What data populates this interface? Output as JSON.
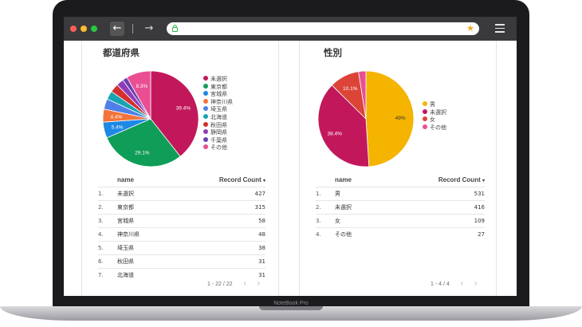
{
  "device": {
    "brand": "NoteBook Pro"
  },
  "browser": {
    "back_glyph": "←",
    "forward_glyph": "→",
    "lock_glyph": "🔒",
    "star_glyph": "★",
    "traffic_lights": [
      "#fc5f56",
      "#fdbb2e",
      "#2bc73f"
    ]
  },
  "prefecture": {
    "title": "都道府県",
    "legend": [
      "未選択",
      "東京都",
      "宮城県",
      "神奈川県",
      "埼玉県",
      "北海道",
      "秋田県",
      "静岡県",
      "千葉県",
      "その他"
    ],
    "chart_data": {
      "type": "pie",
      "title": "都道府県",
      "labels": [
        "未選択",
        "東京都",
        "宮城県",
        "神奈川県",
        "埼玉県",
        "北海道",
        "秋田県",
        "静岡県",
        "千葉県",
        "その他"
      ],
      "values": [
        39.4,
        29.1,
        5.4,
        4.4,
        3.5,
        2.9,
        2.9,
        2.5,
        1.6,
        8.3
      ],
      "colors": [
        "#c2185b",
        "#0f9d58",
        "#1e88e5",
        "#f4733a",
        "#4f7fe8",
        "#16a4b2",
        "#d32f2f",
        "#8e3db8",
        "#6a3fb3",
        "#e94f92"
      ],
      "slice_labels": [
        "39.4%",
        "29.1%",
        "5.4%",
        "4.4%",
        "",
        "",
        "",
        "",
        "",
        "8.3%"
      ]
    },
    "table": {
      "col_name": "name",
      "col_count": "Record Count",
      "sort_glyph": "▾",
      "rows": [
        {
          "idx": "1.",
          "name": "未選択",
          "count": "427"
        },
        {
          "idx": "2.",
          "name": "東京都",
          "count": "315"
        },
        {
          "idx": "3.",
          "name": "宮城県",
          "count": "58"
        },
        {
          "idx": "4.",
          "name": "神奈川県",
          "count": "48"
        },
        {
          "idx": "5.",
          "name": "埼玉県",
          "count": "38"
        },
        {
          "idx": "6.",
          "name": "秋田県",
          "count": "31"
        },
        {
          "idx": "7.",
          "name": "北海道",
          "count": "31"
        }
      ],
      "pagination": "1 - 22 / 22"
    }
  },
  "gender": {
    "title": "性別",
    "legend": [
      "男",
      "未選択",
      "女",
      "その他"
    ],
    "chart_data": {
      "type": "pie",
      "title": "性別",
      "labels": [
        "男",
        "未選択",
        "女",
        "その他"
      ],
      "values": [
        49,
        38.4,
        10.1,
        2.5
      ],
      "colors": [
        "#f4b400",
        "#c2185b",
        "#db4437",
        "#e94f92"
      ],
      "slice_labels": [
        "49%",
        "38.4%",
        "10.1%",
        ""
      ]
    },
    "table": {
      "col_name": "name",
      "col_count": "Record Count",
      "sort_glyph": "▾",
      "rows": [
        {
          "idx": "1.",
          "name": "男",
          "count": "531"
        },
        {
          "idx": "2.",
          "name": "未選択",
          "count": "416"
        },
        {
          "idx": "3.",
          "name": "女",
          "count": "109"
        },
        {
          "idx": "4.",
          "name": "その他",
          "count": "27"
        }
      ],
      "pagination": "1 - 4 / 4"
    }
  },
  "pager_glyphs": {
    "prev": "‹",
    "next": "›"
  }
}
